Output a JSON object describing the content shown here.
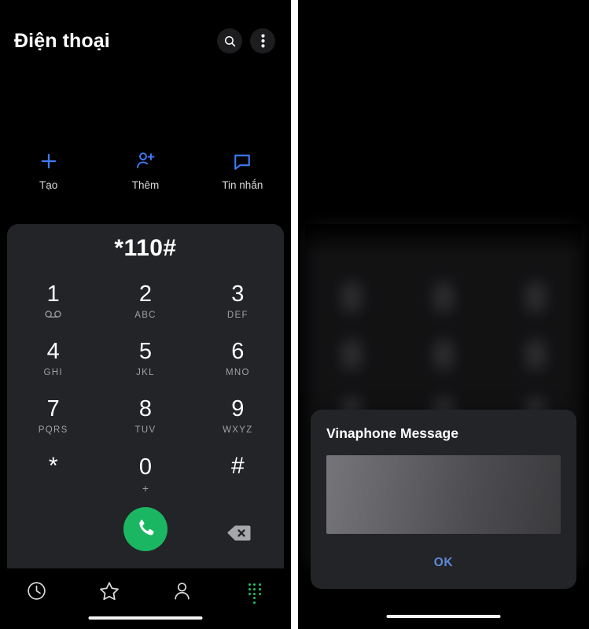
{
  "left_panel": {
    "header": {
      "title": "Điện thoại",
      "search_icon": "search-icon",
      "overflow_icon": "more-vertical-icon"
    },
    "quick_actions": [
      {
        "label": "Tạo",
        "icon": "plus-icon"
      },
      {
        "label": "Thêm",
        "icon": "person-add-icon"
      },
      {
        "label": "Tin nhắn",
        "icon": "message-bubble-icon"
      }
    ],
    "dialpad": {
      "dialed_number": "*110#",
      "keys": [
        {
          "digit": "1",
          "sub": "",
          "icon": "voicemail-icon"
        },
        {
          "digit": "2",
          "sub": "ABC",
          "icon": ""
        },
        {
          "digit": "3",
          "sub": "DEF",
          "icon": ""
        },
        {
          "digit": "4",
          "sub": "GHI",
          "icon": ""
        },
        {
          "digit": "5",
          "sub": "JKL",
          "icon": ""
        },
        {
          "digit": "6",
          "sub": "MNO",
          "icon": ""
        },
        {
          "digit": "7",
          "sub": "PQRS",
          "icon": ""
        },
        {
          "digit": "8",
          "sub": "TUV",
          "icon": ""
        },
        {
          "digit": "9",
          "sub": "WXYZ",
          "icon": ""
        },
        {
          "digit": "*",
          "sub": "",
          "icon": ""
        },
        {
          "digit": "0",
          "sub": "+",
          "icon": ""
        },
        {
          "digit": "#",
          "sub": "",
          "icon": ""
        }
      ],
      "call_button_icon": "phone-call-icon",
      "call_button_color": "#1bb662",
      "backspace_icon": "backspace-icon"
    },
    "bottom_nav": [
      {
        "name": "recents",
        "icon": "clock-icon",
        "active": false
      },
      {
        "name": "favorites",
        "icon": "star-icon",
        "active": false
      },
      {
        "name": "contacts",
        "icon": "person-icon",
        "active": false
      },
      {
        "name": "keypad",
        "icon": "keypad-dots-icon",
        "active": true
      }
    ],
    "accent_color": "#3d7bf7",
    "active_nav_color": "#1fc36a"
  },
  "right_panel": {
    "dialog": {
      "title": "Vinaphone Message",
      "body_text": "",
      "ok_label": "OK",
      "ok_color": "#5c8ad8"
    }
  }
}
